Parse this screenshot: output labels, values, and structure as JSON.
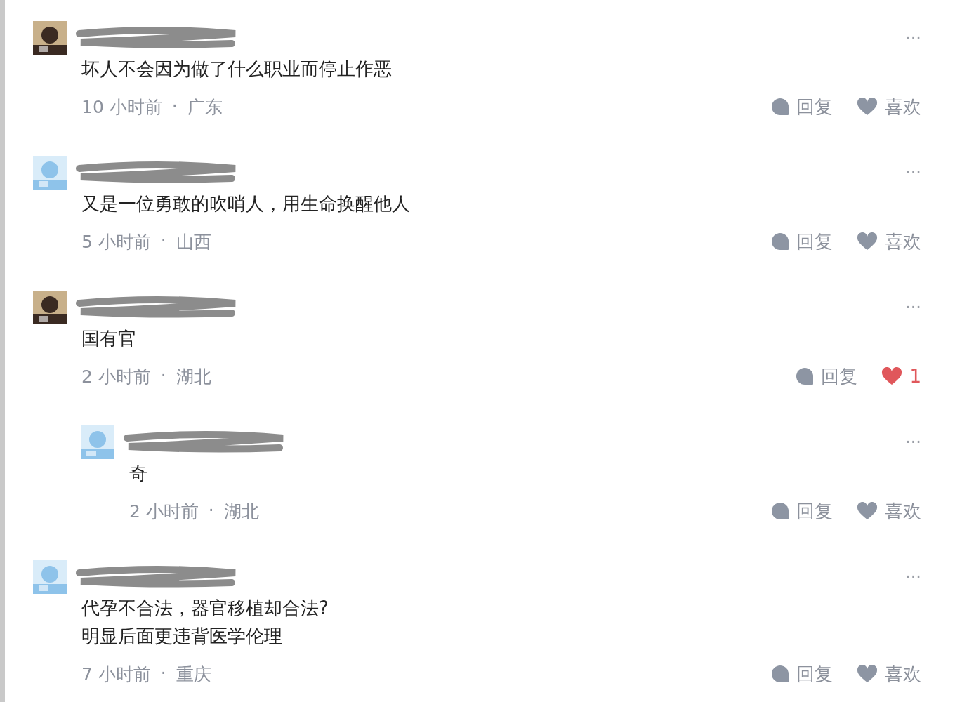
{
  "comments": [
    {
      "more": "···",
      "content": [
        "坏人不会因为做了什么职业而停止作恶"
      ],
      "time": "10 小时前",
      "separator": "·",
      "location": "广东",
      "reply_label": "回复",
      "like": {
        "label": "喜欢",
        "liked": false
      }
    },
    {
      "more": "···",
      "content": [
        "又是一位勇敢的吹哨人，用生命换醒他人"
      ],
      "time": "5 小时前",
      "separator": "·",
      "location": "山西",
      "reply_label": "回复",
      "like": {
        "label": "喜欢",
        "liked": false
      }
    },
    {
      "more": "···",
      "content": [
        "国有官"
      ],
      "time": "2 小时前",
      "separator": "·",
      "location": "湖北",
      "reply_label": "回复",
      "like": {
        "label": "1",
        "liked": true
      },
      "children": [
        {
          "more": "···",
          "content": [
            "奇"
          ],
          "time": "2 小时前",
          "separator": "·",
          "location": "湖北",
          "reply_label": "回复",
          "like": {
            "label": "喜欢",
            "liked": false
          }
        }
      ]
    },
    {
      "more": "···",
      "content": [
        "代孕不合法，器官移植却合法?",
        "明显后面更违背医学伦理"
      ],
      "time": "7 小时前",
      "separator": "·",
      "location": "重庆",
      "reply_label": "回复",
      "like": {
        "label": "喜欢",
        "liked": false
      }
    }
  ]
}
